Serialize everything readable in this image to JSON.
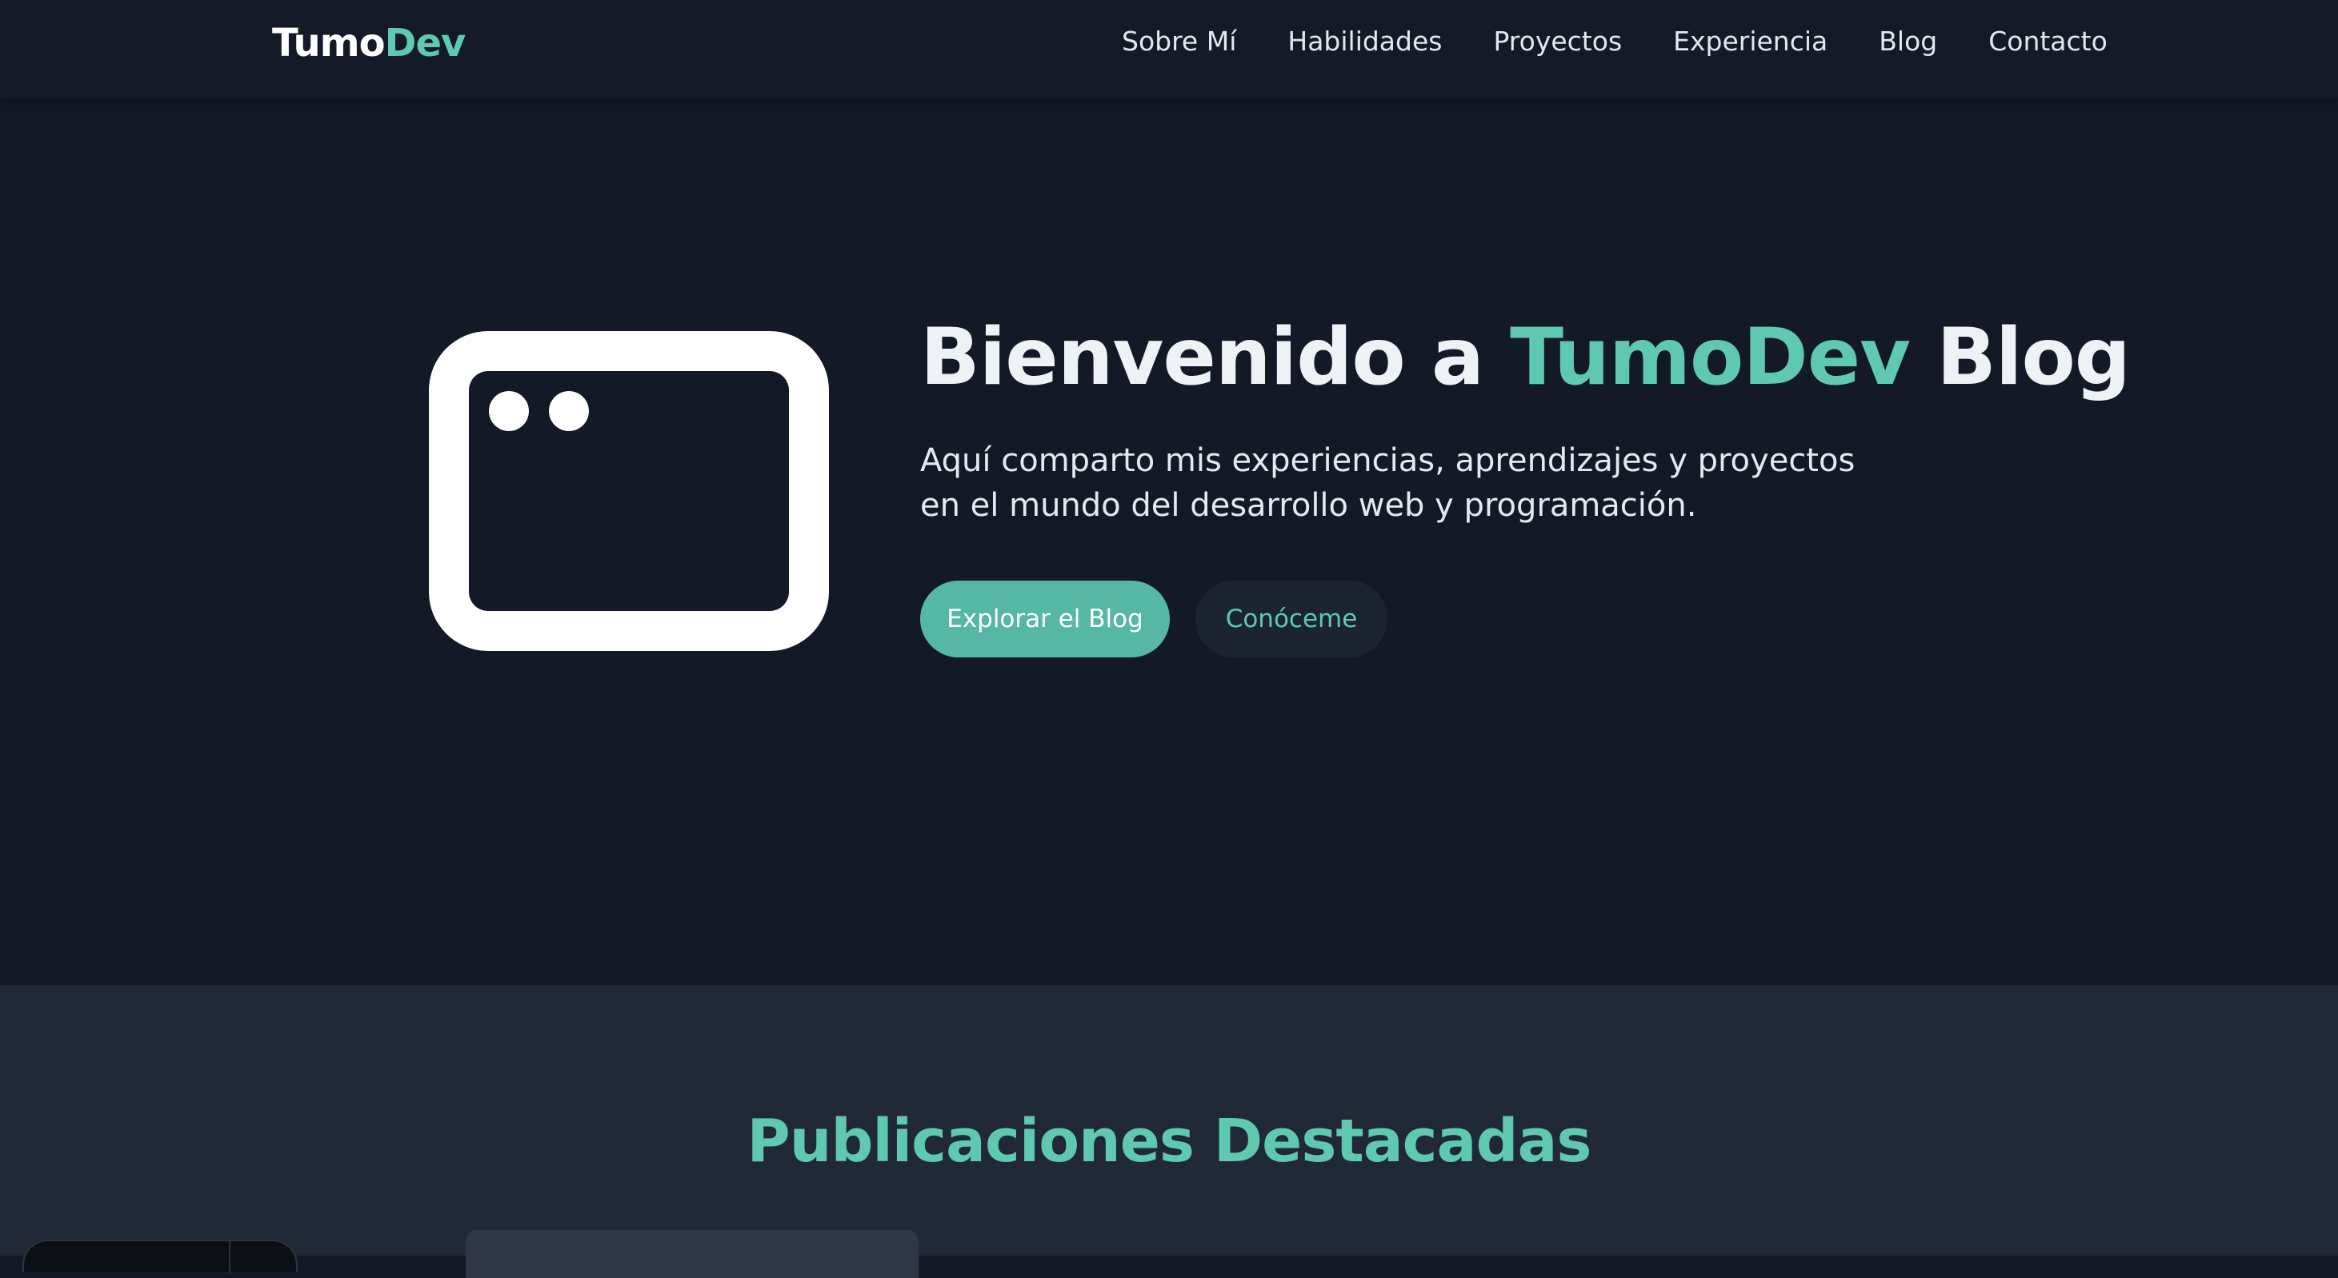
{
  "header": {
    "logo_part1": "Tumo",
    "logo_part2": "Dev",
    "nav": [
      "Sobre Mí",
      "Habilidades",
      "Proyectos",
      "Experiencia",
      "Blog",
      "Contacto"
    ]
  },
  "hero": {
    "icon": "browser-window-icon",
    "title_prefix": "Bienvenido a ",
    "title_accent": "TumoDev",
    "title_suffix": " Blog",
    "subtitle": "Aquí comparto mis experiencias, aprendizajes y proyectos en el mundo del desarrollo web y programación.",
    "primary_button": "Explorar el Blog",
    "secondary_button": "Conóceme"
  },
  "featured": {
    "title": "Publicaciones Destacadas"
  },
  "colors": {
    "background": "#131927",
    "section_background": "#212838",
    "accent": "#5ec9b0",
    "primary_button": "#56b8a4"
  }
}
